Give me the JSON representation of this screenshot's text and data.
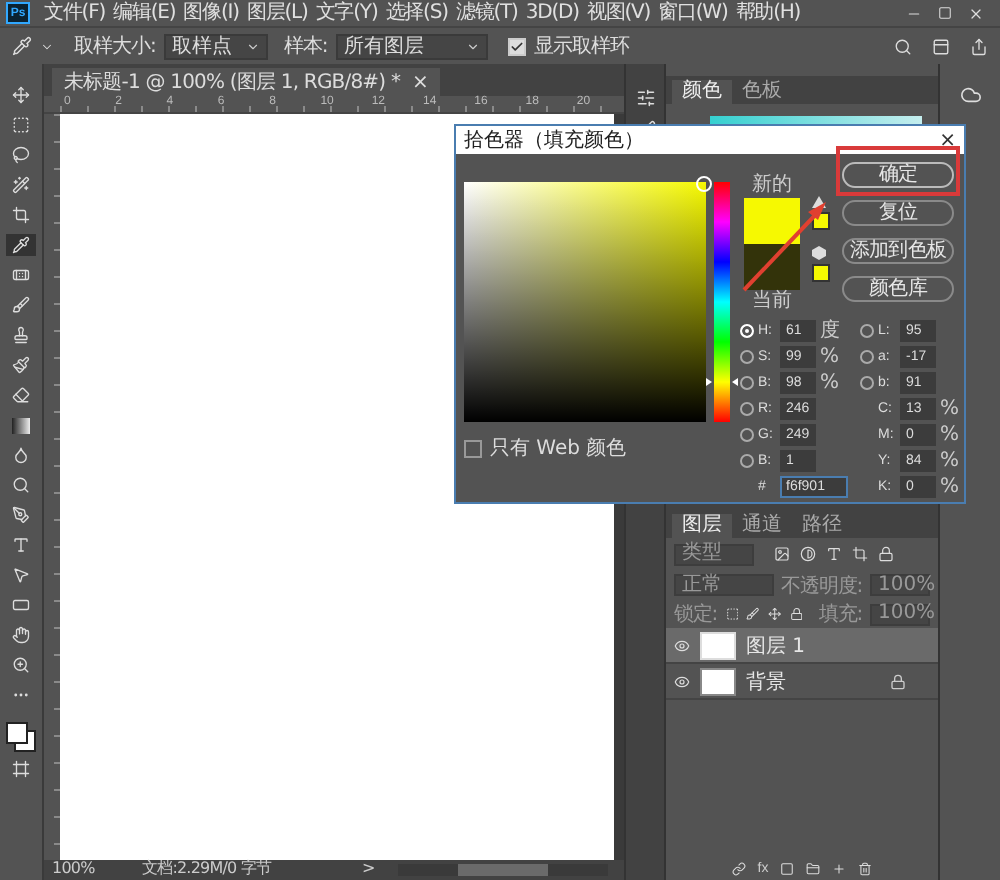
{
  "menu_bar": {
    "logo": "Ps",
    "items": [
      "文件(F)",
      "编辑(E)",
      "图像(I)",
      "图层(L)",
      "文字(Y)",
      "选择(S)",
      "滤镜(T)",
      "3D(D)",
      "视图(V)",
      "窗口(W)",
      "帮助(H)"
    ]
  },
  "options_bar": {
    "sample_size_label": "取样大小:",
    "sample_size": "取样点",
    "sample_label": "样本:",
    "sample": "所有图层",
    "show_ring": {
      "label": "显示取样环",
      "checked": true
    }
  },
  "document_tab": {
    "title": "未标题-1 @ 100% (图层 1, RGB/8#) *",
    "close": "×"
  },
  "ruler": {
    "labels": [
      "0",
      "2",
      "4",
      "6",
      "8",
      "10",
      "12",
      "14",
      "16",
      "18",
      "20"
    ]
  },
  "color_panel": {
    "tabs": [
      {
        "label": "颜色",
        "selected": true
      },
      {
        "label": "色板",
        "selected": false
      }
    ]
  },
  "color_picker": {
    "title": "拾色器（填充颜色）",
    "close": "×",
    "hue_slider": {
      "level": 0.17
    },
    "swatches": [
      {
        "label": "新的",
        "color": "#f6f901"
      },
      {
        "label": "当前",
        "color": "#33330a"
      }
    ],
    "buttons": [
      {
        "label": "确定",
        "highlighted": true
      },
      {
        "label": "复位",
        "highlighted": false
      },
      {
        "label": "添加到色板",
        "highlighted": false
      },
      {
        "label": "颜色库",
        "highlighted": false
      }
    ],
    "hsb_rgb": [
      {
        "label": "H:",
        "value": "61",
        "unit": "度",
        "selected": true
      },
      {
        "label": "S:",
        "value": "99",
        "unit": "%",
        "selected": false
      },
      {
        "label": "B:",
        "value": "98",
        "unit": "%",
        "selected": false
      },
      {
        "label": "R:",
        "value": "246",
        "selected": false
      },
      {
        "label": "G:",
        "value": "249",
        "selected": false
      },
      {
        "label": "B:",
        "value": "1",
        "selected": false
      }
    ],
    "lab": [
      {
        "label": "L:",
        "value": "95",
        "selected": false
      },
      {
        "label": "a:",
        "value": "-17",
        "selected": false
      },
      {
        "label": "b:",
        "value": "91",
        "selected": false
      }
    ],
    "cmyk": [
      {
        "label": "C:",
        "value": "13",
        "unit": "%"
      },
      {
        "label": "M:",
        "value": "0",
        "unit": "%"
      },
      {
        "label": "Y:",
        "value": "84",
        "unit": "%"
      },
      {
        "label": "K:",
        "value": "0",
        "unit": "%"
      }
    ],
    "hex_label": "#",
    "hex": "f6f901",
    "web_only": {
      "label": "只有 Web 颜色",
      "checked": false
    }
  },
  "layers_panel": {
    "tabs": [
      {
        "label": "图层",
        "selected": true
      },
      {
        "label": "通道",
        "selected": false
      },
      {
        "label": "路径",
        "selected": false
      }
    ],
    "filter": "类型",
    "blend_mode": "正常",
    "opacity_label": "不透明度:",
    "opacity": "100%",
    "lock_label": "锁定:",
    "fill_label": "填充:",
    "fill": "100%",
    "layers": [
      {
        "name": "图层 1",
        "selected": true,
        "locked": false
      },
      {
        "name": "背景",
        "selected": false,
        "locked": true
      }
    ],
    "footer_fx": "fx"
  },
  "status_bar": {
    "zoom": "100%",
    "doc_info": "文档:2.29M/0 字节",
    "arrow": ">"
  }
}
